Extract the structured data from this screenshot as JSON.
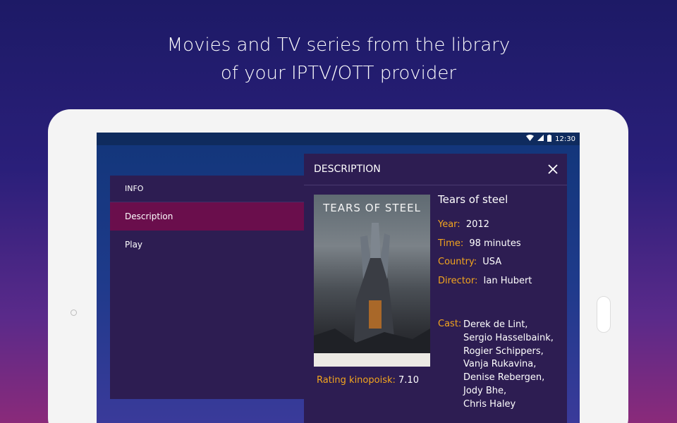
{
  "headline": {
    "line1": "Movies and TV series from the library",
    "line2": "of your IPTV/OTT provider"
  },
  "statusbar": {
    "time": "12:30",
    "icons": [
      "wifi-icon",
      "signal-icon",
      "battery-icon"
    ]
  },
  "side_panel": {
    "header": "INFO",
    "items": [
      {
        "label": "Description",
        "active": true
      },
      {
        "label": "Play",
        "active": false
      }
    ]
  },
  "description_panel": {
    "header": "DESCRIPTION",
    "close_icon": "close-icon",
    "poster_title": "TEARS OF STEEL",
    "title": "Tears of steel",
    "fields": [
      {
        "label": "Year:",
        "value": "2012"
      },
      {
        "label": "Time:",
        "value": "98 minutes"
      },
      {
        "label": "Country:",
        "value": "USA"
      },
      {
        "label": "Director:",
        "value": "Ian Hubert"
      }
    ],
    "cast_label": "Cast:",
    "cast": [
      "Derek de Lint,",
      "Sergio Hasselbaink,",
      "Rogier Schippers,",
      "Vanja Rukavina,",
      "Denise Rebergen,",
      "Jody Bhe,",
      "Chris Haley"
    ],
    "rating_label": "Rating kinopoisk:",
    "rating_value": "7.10"
  },
  "colors": {
    "accent_label": "#f3a51e",
    "active_item": "#6a0e4c",
    "panel_bg": "#2d1d52"
  }
}
